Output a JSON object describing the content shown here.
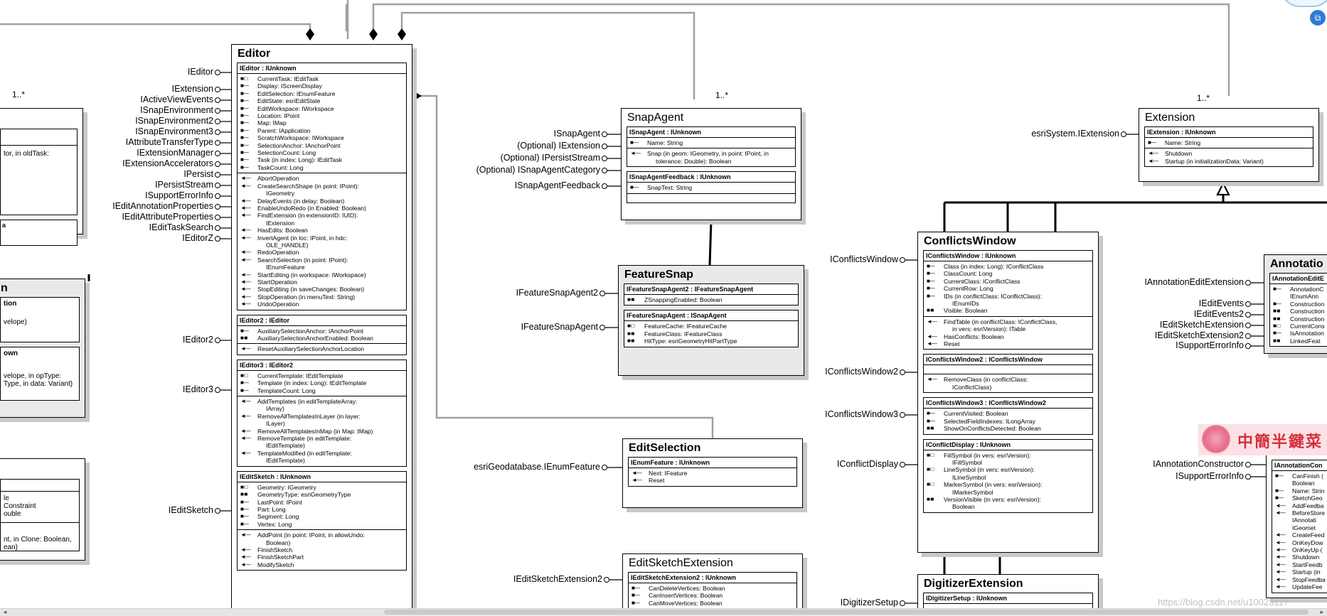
{
  "editor": {
    "title": "Editor",
    "interfaces": [
      {
        "head": "IEditor : IUnknown",
        "sections": [
          [
            {
              "s": "■-□",
              "t": "CurrentTask: IEditTask"
            },
            {
              "s": "■—",
              "t": "Display: IScreenDisplay"
            },
            {
              "s": "■—",
              "t": "EditSelection: IEnumFeature"
            },
            {
              "s": "■—",
              "t": "EditState: esriEditState"
            },
            {
              "s": "■—",
              "t": "EditWorkspace: IWorkspace"
            },
            {
              "s": "■—",
              "t": "Location: IPoint"
            },
            {
              "s": "■—",
              "t": "Map: IMap"
            },
            {
              "s": "■—",
              "t": "Parent: IApplication"
            },
            {
              "s": "■—",
              "t": "ScratchWorkspace: IWorkspace"
            },
            {
              "s": "■—",
              "t": "SelectionAnchor: IAnchorPoint"
            },
            {
              "s": "■—",
              "t": "SelectionCount: Long"
            },
            {
              "s": "■—",
              "t": "Task (in index: Long): IEditTask"
            },
            {
              "s": "■—",
              "t": "TaskCount: Long"
            }
          ],
          [
            {
              "s": "◄—",
              "t": "AbortOperation"
            },
            {
              "s": "◄—",
              "t": "CreateSearchShape (in point: IPoint):\n     IGeometry"
            },
            {
              "s": "◄—",
              "t": "DelayEvents (in delay: Boolean)"
            },
            {
              "s": "◄—",
              "t": "EnableUndoRedo (in Enabled: Boolean)"
            },
            {
              "s": "◄—",
              "t": "FindExtension (in extensionID: IUID):\n     IExtension"
            },
            {
              "s": "◄—",
              "t": "HasEdits: Boolean"
            },
            {
              "s": "◄—",
              "t": "InvertAgent (in loc: IPoint, in hdc:\n     OLE_HANDLE)"
            },
            {
              "s": "◄—",
              "t": "RedoOperation"
            },
            {
              "s": "◄—",
              "t": "SearchSelection (in point: IPoint):\n     IEnumFeature"
            },
            {
              "s": "◄—",
              "t": "StartEditing (in workspace: IWorkspace)"
            },
            {
              "s": "◄—",
              "t": "StartOperation"
            },
            {
              "s": "◄—",
              "t": "StopEditing (in saveChanges: Boolean)"
            },
            {
              "s": "◄—",
              "t": "StopOperation (in menuText: String)"
            },
            {
              "s": "◄—",
              "t": "UndoOperation"
            }
          ]
        ]
      },
      {
        "head": "IEditor2 : IEditor",
        "sections": [
          [
            {
              "s": "■—",
              "t": "AuxiliarySelectionAnchor: IAnchorPoint"
            },
            {
              "s": "■-■",
              "t": "AuxiliarySelectionAnchorEnabled: Boolean"
            }
          ],
          [
            {
              "s": "◄—",
              "t": "ResetAuxiliarySelectionAnchorLocation"
            }
          ]
        ]
      },
      {
        "head": "IEditor3 : IEditor2",
        "sections": [
          [
            {
              "s": "■-□",
              "t": "CurrentTemplate: IEditTemplate"
            },
            {
              "s": "■—",
              "t": "Template (in index: Long): IEditTemplate"
            },
            {
              "s": "■—",
              "t": "TemplateCount: Long"
            }
          ],
          [
            {
              "s": "◄—",
              "t": "AddTemplates (in editTemplateArray:\n     IArray)"
            },
            {
              "s": "◄—",
              "t": "RemoveAllTemplatesInLayer (in layer:\n     ILayer)"
            },
            {
              "s": "◄—",
              "t": "RemoveAllTemplatesInMap (in Map: IMap)"
            },
            {
              "s": "◄—",
              "t": "RemoveTemplate (in editTemplate:\n     IEditTemplate)"
            },
            {
              "s": "◄—",
              "t": "TemplateModified (in editTemplate:\n     IEditTemplate)"
            }
          ]
        ]
      },
      {
        "head": "IEditSketch : IUnknown",
        "sections": [
          [
            {
              "s": "■-□",
              "t": "Geometry: IGeometry"
            },
            {
              "s": "■-■",
              "t": "GeometryType: esriGeometryType"
            },
            {
              "s": "■—",
              "t": "LastPoint: IPoint"
            },
            {
              "s": "■—",
              "t": "Part: Long"
            },
            {
              "s": "■—",
              "t": "Segment: Long"
            },
            {
              "s": "■—",
              "t": "Vertex: Long"
            }
          ],
          [
            {
              "s": "◄—",
              "t": "AddPoint (in point: IPoint, in allowUndo:\n     Boolean)"
            },
            {
              "s": "◄—",
              "t": "FinishSketch"
            },
            {
              "s": "◄—",
              "t": "FinishSketchPart"
            },
            {
              "s": "◄—",
              "t": "ModifySketch"
            }
          ]
        ]
      }
    ],
    "labels": [
      "IEditor",
      "IExtension",
      "IActiveViewEvents",
      "ISnapEnvironment",
      "ISnapEnvironment2",
      "ISnapEnvironment3",
      "IAttributeTransferType",
      "IExtensionManager",
      "IExtensionAccelerators",
      "IPersist",
      "IPersistStream",
      "ISupportErrorInfo",
      "IEditAnnotationProperties",
      "IEditAttributeProperties",
      "IEditTaskSearch",
      "IEditorZ",
      "IEditor2",
      "IEditor3",
      "IEditSketch"
    ]
  },
  "snap_agent": {
    "title": "SnapAgent",
    "interfaces": [
      {
        "head": "ISnapAgent : IUnknown",
        "sections": [
          [
            {
              "s": "■—",
              "t": "Name: String"
            }
          ],
          [
            {
              "s": "◄—",
              "t": "Snap (in geom: IGeometry, in point: IPoint, in\n     tolerance: Double): Boolean"
            }
          ]
        ]
      },
      {
        "head": "ISnapAgentFeedback : IUnknown",
        "sections": [
          [
            {
              "s": "■—",
              "t": "SnapText: String"
            }
          ],
          []
        ]
      }
    ],
    "labels": [
      "ISnapAgent",
      "(Optional)  IExtension",
      "(Optional)  IPersistStream",
      "(Optional)  ISnapAgentCategory",
      "ISnapAgentFeedback"
    ]
  },
  "feature_snap": {
    "title": "FeatureSnap",
    "interfaces": [
      {
        "head": "IFeatureSnapAgent2 : IFeatureSnapAgent",
        "sections": [
          [
            {
              "s": "■-■",
              "t": "ZSnappingEnabled: Boolean"
            }
          ]
        ]
      },
      {
        "head": "IFeatureSnapAgent : ISnapAgent",
        "sections": [
          [
            {
              "s": "■-□",
              "t": "FeatureCache: IFeatureCache"
            },
            {
              "s": "■-■",
              "t": "FeatureClass: IFeatureClass"
            },
            {
              "s": "■-■",
              "t": "HitType: esriGeometryHitPartType"
            }
          ]
        ]
      }
    ],
    "labels": [
      "IFeatureSnapAgent2",
      "IFeatureSnapAgent"
    ]
  },
  "edit_selection": {
    "title": "EditSelection",
    "interfaces": [
      {
        "head": "IEnumFeature : IUnknown",
        "sections": [
          [
            {
              "s": "◄—",
              "t": "Next: IFeature"
            },
            {
              "s": "◄—",
              "t": "Reset"
            }
          ]
        ]
      }
    ],
    "labels": [
      "esriGeodatabase.IEnumFeature"
    ]
  },
  "edit_sketch_extension": {
    "title": "EditSketchExtension",
    "interfaces": [
      {
        "head": "IEditSketchExtension2 : IUnknown",
        "sections": [
          [
            {
              "s": "■—",
              "t": "CanDeleteVertices: Boolean"
            },
            {
              "s": "■—",
              "t": "CanInsertVertices: Boolean"
            },
            {
              "s": "■—",
              "t": "CanMoveVertices: Boolean"
            }
          ]
        ]
      }
    ],
    "labels": [
      "IEditSketchExtension2"
    ]
  },
  "extension": {
    "title": "Extension",
    "interfaces": [
      {
        "head": "IExtension : IUnknown",
        "sections": [
          [
            {
              "s": "■—",
              "t": "Name: String"
            }
          ],
          [
            {
              "s": "◄—",
              "t": "Shutdown"
            },
            {
              "s": "◄—",
              "t": "Startup (in initializationData: Variant)"
            }
          ]
        ]
      }
    ],
    "labels": [
      "esriSystem.IExtension"
    ]
  },
  "conflicts_window": {
    "title": "ConflictsWindow",
    "interfaces": [
      {
        "head": "IConflictsWindow : IUnknown",
        "sections": [
          [
            {
              "s": "■—",
              "t": "Class (in index: Long): IConflictClass"
            },
            {
              "s": "■—",
              "t": "ClassCount: Long"
            },
            {
              "s": "■—",
              "t": "CurrentClass: IConflictClass"
            },
            {
              "s": "■—",
              "t": "CurrentRow: Long"
            },
            {
              "s": "■—",
              "t": "IDs (in conflictClass: IConflictClass):\n     IEnumIDs"
            },
            {
              "s": "■-■",
              "t": "Visible: Boolean"
            }
          ],
          [
            {
              "s": "◄—",
              "t": "FindTable (in conflictClass: IConflictClass,\n     in vers: esriVersion): ITable"
            },
            {
              "s": "◄—",
              "t": "HasConflicts: Boolean"
            },
            {
              "s": "◄—",
              "t": "Reset"
            }
          ]
        ]
      },
      {
        "head": "IConflictsWindow2 : IConflictsWindow",
        "sections": [
          [],
          [
            {
              "s": "◄—",
              "t": "RemoveClass (in conflictClass:\n     IConflictClass)"
            }
          ]
        ]
      },
      {
        "head": "IConflictsWindow3 : IConflictsWindow2",
        "sections": [
          [
            {
              "s": "■—",
              "t": "CurrentVisited: Boolean"
            },
            {
              "s": "■—",
              "t": "SelectedFieldIndexes: ILongArray"
            },
            {
              "s": "■-■",
              "t": "ShowOnConflictsDetected: Boolean"
            }
          ]
        ]
      },
      {
        "head": "IConflictDisplay : IUnknown",
        "sections": [
          [
            {
              "s": "■-□",
              "t": "FillSymbol (in vers: esriVersion):\n     IFillSymbol"
            },
            {
              "s": "■-□",
              "t": "LineSymbol (in vers: esriVersion):\n     ILineSymbol"
            },
            {
              "s": "■-□",
              "t": "MarkerSymbol (in vers: esriVersion):\n     IMarkerSymbol"
            },
            {
              "s": "■-■",
              "t": "VersionVisible (in vers: esriVersion):\n     Boolean"
            }
          ]
        ]
      }
    ],
    "labels": [
      "IConflictsWindow",
      "IConflictsWindow2",
      "IConflictsWindow3",
      "IConflictDisplay"
    ]
  },
  "digitizer_extension": {
    "title": "DigitizerExtension",
    "interfaces": [
      {
        "head": "IDigitizerSetup : IUnknown",
        "sections": [
          []
        ]
      }
    ],
    "labels": [
      "IDigitizerSetup"
    ]
  },
  "annotation": {
    "title": "Annotatio",
    "head1": "IAnnotationEditE",
    "members1": [
      {
        "s": "■—",
        "t": "AnnotationC"
      },
      {
        "s": "",
        "t": "IEnumAnn"
      },
      {
        "s": "■—",
        "t": "Construction"
      },
      {
        "s": "■-■",
        "t": "Construction"
      },
      {
        "s": "■-■",
        "t": "Construction"
      },
      {
        "s": "■-□",
        "t": "CurrentCons"
      },
      {
        "s": "■—",
        "t": "IsAnnotation"
      },
      {
        "s": "■-■",
        "t": "LinkedFeat"
      }
    ],
    "labels": [
      "IAnnotationEditExtension",
      "IEditEvents",
      "IEditEvents2",
      "IEditSketchExtension",
      "IEditSketchExtension2",
      "ISupportErrorInfo"
    ],
    "head2": "IAnnotationCon",
    "members2": [
      {
        "s": "■—",
        "t": "CanFinish ("
      },
      {
        "s": "",
        "t": "Boolean"
      },
      {
        "s": "■—",
        "t": "Name: Strin"
      },
      {
        "s": "■—",
        "t": "SketchGeo"
      },
      {
        "s": "◄—",
        "t": "AddFeedba"
      },
      {
        "s": "◄—",
        "t": "BeforeStore"
      },
      {
        "s": "",
        "t": "IAnnotati"
      },
      {
        "s": "",
        "t": "IGeomet"
      },
      {
        "s": "◄—",
        "t": "CreateFeed"
      },
      {
        "s": "◄—",
        "t": "OnKeyDow"
      },
      {
        "s": "◄—",
        "t": "OnKeyUp ("
      },
      {
        "s": "◄—",
        "t": "Shutdown"
      },
      {
        "s": "◄—",
        "t": "StartFeedb"
      },
      {
        "s": "◄—",
        "t": "Startup (in"
      },
      {
        "s": "◄—",
        "t": "StopFeedba"
      },
      {
        "s": "◄—",
        "t": "UpdateFee"
      }
    ],
    "labels2": [
      "IAnnotationConstructor",
      "ISupportErrorInfo"
    ]
  },
  "left_fragments": {
    "mult": "1..*",
    "frag1": [
      "tor, in oldTask:"
    ],
    "frag2_title": "n",
    "frag2_lines": [
      "tion",
      "velope)",
      "own",
      "velope, in opType:",
      "Type, in data: Variant)"
    ],
    "frag3_lines": [
      "le",
      "Constraint",
      "ouble",
      "nt, in Clone: Boolean,",
      "ean)"
    ]
  },
  "multiplicities": {
    "snap": "1..*",
    "extension": "1..*"
  },
  "watermark": "https://blog.csdn.net/u1002311?",
  "banner_text": "中簡半鍵菜",
  "accent_blue": "#2e7bd6"
}
